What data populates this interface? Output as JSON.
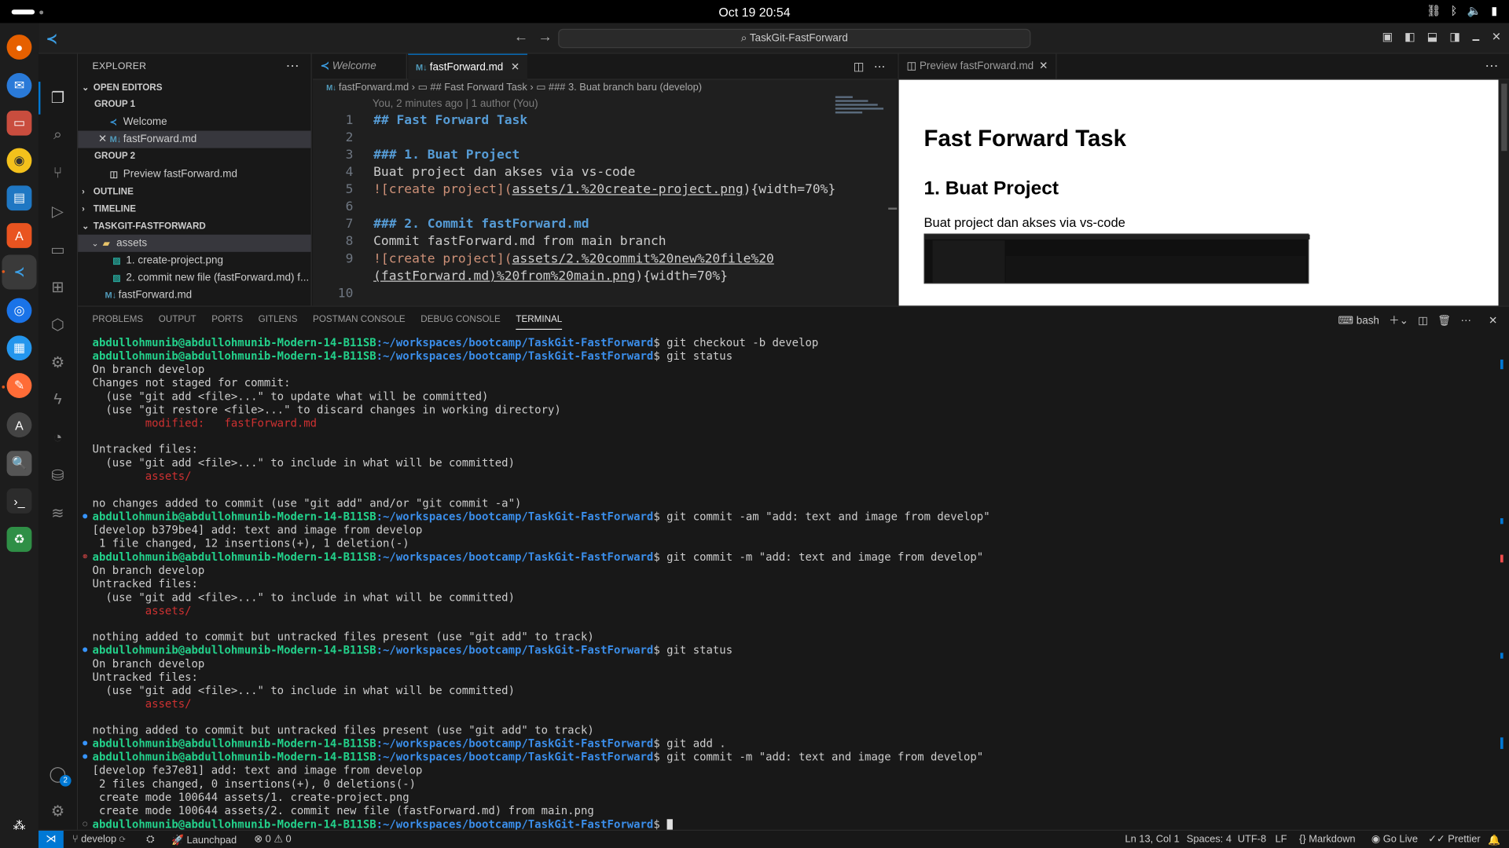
{
  "system": {
    "clock": "Oct 19  20:54",
    "tray_icons": [
      "network-icon",
      "bluetooth-icon",
      "volume-icon",
      "battery-icon",
      "power-icon"
    ]
  },
  "titlebar": {
    "search": "TaskGit-FastForward"
  },
  "activity": {
    "accounts_badge": "2"
  },
  "explorer": {
    "title": "EXPLORER",
    "open_editors": "OPEN EDITORS",
    "group1": "GROUP 1",
    "welcome": "Welcome",
    "fastforward": "fastForward.md",
    "group2": "GROUP 2",
    "preview": "Preview fastForward.md",
    "outline": "OUTLINE",
    "timeline": "TIMELINE",
    "project": "TASKGIT-FASTFORWARD",
    "assets_folder": "assets",
    "asset1": "1. create-project.png",
    "asset2": "2. commit new file (fastForward.md) f...",
    "root_file": "fastForward.md"
  },
  "editor": {
    "tab_welcome": "Welcome",
    "tab_active": "fastForward.md",
    "breadcrumb_file": "fastForward.md",
    "breadcrumb_h2": "## Fast Forward Task",
    "breadcrumb_h3": "### 3. Buat branch baru (develop)",
    "blame": "You, 2 minutes ago | 1 author (You)",
    "lines": {
      "l1": "## Fast Forward Task",
      "l3": "### 1. Buat Project",
      "l4": "Buat project dan akses via vs-code",
      "l5a": "![create project](",
      "l5b": "assets/1.%20create-project.png",
      "l5c": "){width=70%}",
      "l7": "### 2. Commit fastForward.md",
      "l8": "Commit fastForward.md from main branch",
      "l9a": "![create project](",
      "l9b": "assets/2.%20commit%20new%20file%20",
      "l9c": "(fastForward.md)%20from%20main.png",
      "l9d": "){width=70%}"
    },
    "line_numbers": [
      "1",
      "2",
      "3",
      "4",
      "5",
      "6",
      "7",
      "8",
      "9",
      "10"
    ]
  },
  "preview": {
    "tab": "Preview fastForward.md",
    "h1": "Fast Forward Task",
    "h2": "1. Buat Project",
    "p": "Buat project dan akses via vs-code"
  },
  "panel": {
    "tabs": [
      "PROBLEMS",
      "OUTPUT",
      "PORTS",
      "GITLENS",
      "POSTMAN CONSOLE",
      "DEBUG CONSOLE",
      "TERMINAL"
    ],
    "shell": "bash",
    "prompt_user": "abdullohmunib@abdullohmunib-Modern-14-B11SB",
    "prompt_path": ":~/workspaces/bootcamp/TaskGit-FastForward",
    "terminal": {
      "c1": "$ git checkout -b develop",
      "c2": "$ git status",
      "o1": "On branch develop",
      "o2": "Changes not staged for commit:",
      "o3": "  (use \"git add <file>...\" to update what will be committed)",
      "o4": "  (use \"git restore <file>...\" to discard changes in working directory)",
      "o5": "        modified:   fastForward.md",
      "o6": "Untracked files:",
      "o7": "  (use \"git add <file>...\" to include in what will be committed)",
      "o8": "        assets/",
      "o9": "no changes added to commit (use \"git add\" and/or \"git commit -a\")",
      "c3": "$ git commit -am \"add: text and image from develop\"",
      "o10": "[develop b379be4] add: text and image from develop",
      "o11": " 1 file changed, 12 insertions(+), 1 deletion(-)",
      "c4": "$ git commit -m \"add: text and image from develop\"",
      "o12": "On branch develop",
      "o13": "Untracked files:",
      "o14": "  (use \"git add <file>...\" to include in what will be committed)",
      "o15": "        assets/",
      "o16": "nothing added to commit but untracked files present (use \"git add\" to track)",
      "c5": "$ git status",
      "o17": "On branch develop",
      "o18": "Untracked files:",
      "o19": "  (use \"git add <file>...\" to include in what will be committed)",
      "o20": "        assets/",
      "o21": "nothing added to commit but untracked files present (use \"git add\" to track)",
      "c6": "$ git add .",
      "c7": "$ git commit -m \"add: text and image from develop\"",
      "o22": "[develop fe37e81] add: text and image from develop",
      "o23": " 2 files changed, 0 insertions(+), 0 deletions(-)",
      "o24": " create mode 100644 assets/1. create-project.png",
      "o25": " create mode 100644 assets/2. commit new file (fastForward.md) from main.png",
      "c8": "$ "
    }
  },
  "statusbar": {
    "branch": "develop",
    "launchpad": "Launchpad",
    "problems": "0",
    "warnings": "0",
    "position": "Ln 13, Col 1",
    "spaces": "Spaces: 4",
    "encoding": "UTF-8",
    "eol": "LF",
    "language": "Markdown",
    "golive": "Go Live",
    "prettier": "Prettier"
  }
}
